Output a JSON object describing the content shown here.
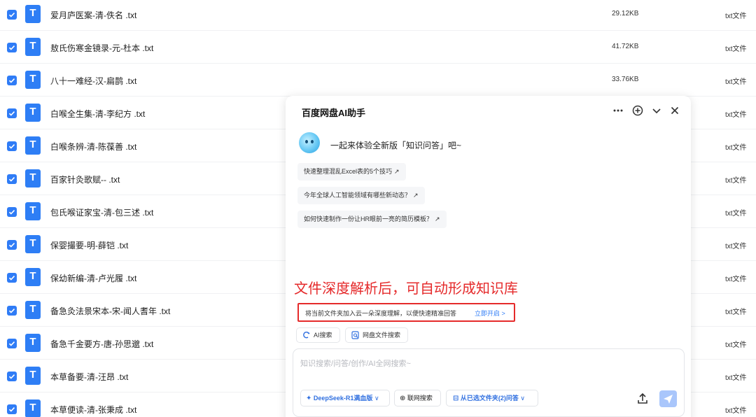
{
  "files": [
    {
      "name": "爱月庐医案-清-佚名 .txt",
      "size": "29.12KB",
      "type": "txt文件"
    },
    {
      "name": "敖氏伤寒金镜录-元-杜本 .txt",
      "size": "41.72KB",
      "type": "txt文件"
    },
    {
      "name": "八十一难经-汉-扁鹊 .txt",
      "size": "33.76KB",
      "type": "txt文件"
    },
    {
      "name": "白喉全生集-清-李纪方 .txt",
      "size": "",
      "type": "txt文件"
    },
    {
      "name": "白喉条辨-清-陈葆善 .txt",
      "size": "",
      "type": "txt文件"
    },
    {
      "name": "百家针灸歌赋-- .txt",
      "size": "",
      "type": "txt文件"
    },
    {
      "name": "包氏喉证家宝-清-包三述 .txt",
      "size": "",
      "type": "txt文件"
    },
    {
      "name": "保婴撮要-明-薛铠 .txt",
      "size": "",
      "type": "txt文件"
    },
    {
      "name": "保幼新编-清-卢光履 .txt",
      "size": "",
      "type": "txt文件"
    },
    {
      "name": "备急灸法景宋本-宋-闻人耆年 .txt",
      "size": "",
      "type": "txt文件"
    },
    {
      "name": "备急千金要方-唐-孙思邈 .txt",
      "size": "",
      "type": "txt文件"
    },
    {
      "name": "本草备要-清-汪昂 .txt",
      "size": "",
      "type": "txt文件"
    },
    {
      "name": "本草便读-清-张秉成 .txt",
      "size": "",
      "type": "txt文件"
    }
  ],
  "file_icon_letter": "T",
  "accent_color": "#2f7cf6",
  "assistant": {
    "title": "百度网盘AI助手",
    "welcome": "一起来体验全新版「知识问答」吧~",
    "suggestions": [
      "快速整理混乱Excel表的5个技巧",
      "今年全球人工智能领域有哪些新动态？",
      "如何快速制作一份让HR眼前一亮的简历模板？"
    ],
    "annotation": "文件深度解析后，可自动形成知识库",
    "kb_prompt": "将当前文件夹加入云一朵深度理解，以便快速精准回答",
    "kb_action": "立即开启 >",
    "chips": [
      "AI搜索",
      "网盘文件搜索"
    ],
    "input_placeholder": "知识搜索/问答/创作/AI全网搜索~",
    "model_label": "DeepSeek-R1满血版",
    "web_search_label": "联网搜索",
    "scope_label": "从已选文件夹(2)问答"
  }
}
